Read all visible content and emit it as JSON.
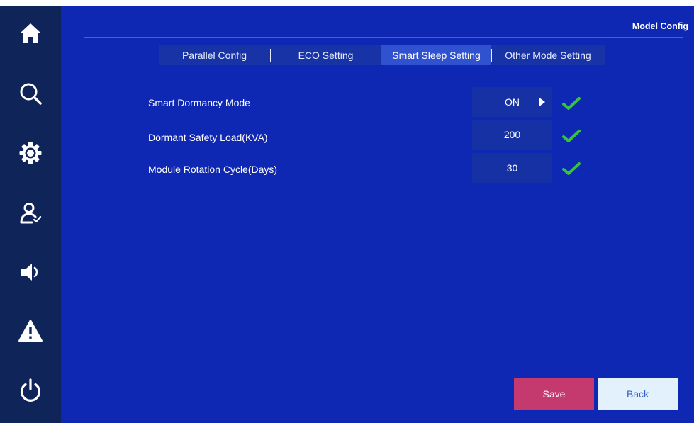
{
  "header": {
    "title": "Model Config"
  },
  "tabs": [
    {
      "label": "Parallel Config",
      "active": false
    },
    {
      "label": "ECO Setting",
      "active": false
    },
    {
      "label": "Smart Sleep Setting",
      "active": true
    },
    {
      "label": "Other Mode Setting",
      "active": false
    }
  ],
  "settings": [
    {
      "label": "Smart Dormancy Mode",
      "value": "ON",
      "confirmed": true
    },
    {
      "label": "Dormant Safety Load(KVA)",
      "value": "200",
      "confirmed": true
    },
    {
      "label": "Module Rotation Cycle(Days)",
      "value": "30",
      "confirmed": true
    }
  ],
  "sidebar": {
    "items": [
      {
        "icon": "home-icon"
      },
      {
        "icon": "search-icon"
      },
      {
        "icon": "gear-icon"
      },
      {
        "icon": "user-icon"
      },
      {
        "icon": "speaker-icon"
      },
      {
        "icon": "warning-icon"
      },
      {
        "icon": "power-icon"
      }
    ]
  },
  "actions": {
    "save_label": "Save",
    "back_label": "Back"
  },
  "colors": {
    "sidebar": "#0f2459",
    "main_background": "#0f28b4",
    "tab_active": "#3152cf",
    "save_button": "#c4396e",
    "back_button": "#e3f1fd",
    "check_mark": "#36c43c"
  }
}
